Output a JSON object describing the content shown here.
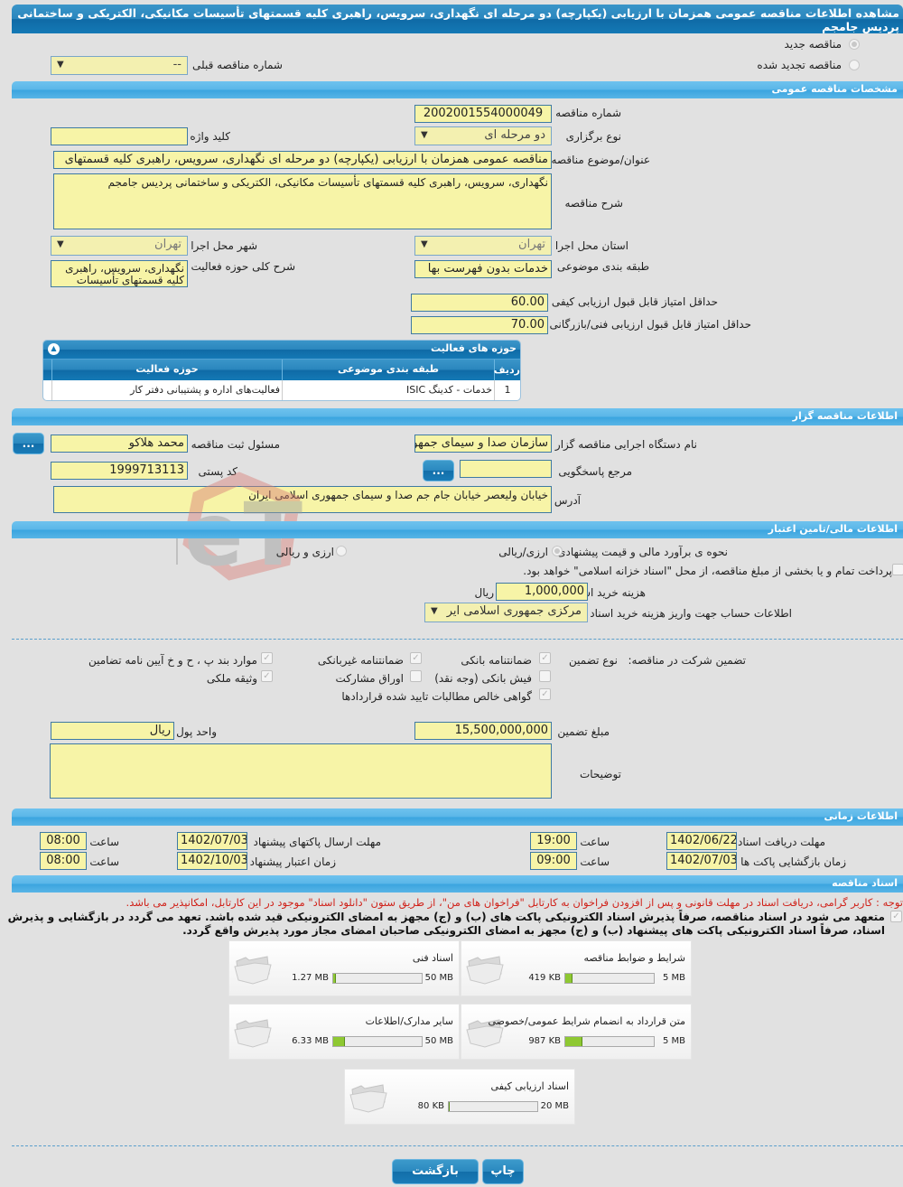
{
  "page_title": "مشاهده اطلاعات مناقصه عمومی همزمان با ارزیابی (یکپارچه) دو مرحله ای نگهداری، سرویس، راهبری کلیه قسمتهای تأسیسات مکانیکی، الکتریکی و ساختمانی پردیس جامجم",
  "tender_type": {
    "new_label": "مناقصه جدید",
    "renewed_label": "مناقصه تجدید شده",
    "prev_number_label": "شماره مناقصه قبلی",
    "prev_number_value": "--"
  },
  "general": {
    "section_title": "مشخصات مناقصه عمومی",
    "tender_number_label": "شماره مناقصه",
    "tender_number": "2002001554000049",
    "holding_type_label": "نوع برگزاری",
    "holding_type": "دو مرحله ای",
    "keyword_label": "کلید واژه",
    "keyword": "",
    "subject_label": "عنوان/موضوع مناقصه",
    "subject": "مناقصه عمومی همزمان با ارزیابی (یکپارچه) دو مرحله ای نگهداری، سرویس، راهبری کلیه قسمتهای",
    "description_label": "شرح مناقصه",
    "description": "نگهداری، سرویس، راهبری کلیه قسمتهای تأسیسات مکانیکی، الکتریکی و ساختمانی پردیس جامجم",
    "province_label": "استان محل اجرا",
    "province": "تهران",
    "city_label": "شهر محل اجرا",
    "city": "تهران",
    "category_label": "طبقه بندی موضوعی",
    "category": "خدمات بدون فهرست بها",
    "activity_desc_label": "شرح کلی حوزه فعالیت",
    "activity_desc": "نگهداری، سرویس، راهبری کلیه قسمتهای تأسیسات",
    "min_quality_label": "حداقل امتیاز قابل قبول ارزیابی کیفی",
    "min_quality": "60.00",
    "min_tech_label": "حداقل امتیاز قابل قبول ارزیابی فنی/بازرگانی",
    "min_tech": "70.00"
  },
  "activity_grid": {
    "title": "حوزه های فعالیت",
    "columns": [
      "ردیف",
      "طبقه بندی موضوعی",
      "حوزه فعالیت"
    ],
    "rows": [
      {
        "index": "1",
        "category": "خدمات - کدینگ ISIC",
        "field": "فعالیت‌های  اداره و پشتیبانی دفتر کار"
      }
    ]
  },
  "organizer": {
    "section_title": "اطلاعات مناقصه گزار",
    "org_name_label": "نام دستگاه اجرایی مناقصه گزار",
    "org_name": "سازمان صدا و سیمای جمهوری اسلامی ایران",
    "registrar_label": "مسئول ثبت مناقصه",
    "registrar": "محمد هلاکو",
    "reference_label": "مرجع پاسخگویی",
    "reference": "",
    "postal_label": "کد پستی",
    "postal": "1999713113",
    "address_label": "آدرس",
    "address": "خیابان ولیعصر خیابان جام جم صدا و سیمای جمهوری اسلامی ایران",
    "dots_label": "..."
  },
  "financial": {
    "section_title": "اطلاعات مالی/تامین اعتبار",
    "estimate_label": "نحوه ی برآورد مالی و قیمت پیشنهادی",
    "opt_rial": "ارزی/ریالی",
    "opt_fx_rial": "ارزی و ریالی",
    "treasury_note": "پرداخت تمام و یا بخشی از مبلغ مناقصه، از محل \"اسناد خزانه اسلامی\" خواهد بود.",
    "doc_fee_label": "هزینه خرید اسناد",
    "doc_fee": "1,000,000",
    "doc_fee_unit": "ریال",
    "account_label": "اطلاعات حساب جهت واریز هزینه خرید اسناد",
    "account": "مرکزی جمهوری اسلامی ایر"
  },
  "guarantee": {
    "title_label": "تضمین شرکت در مناقصه:",
    "type_label": "نوع تضمین",
    "options": [
      {
        "label": "ضمانتنامه بانکی",
        "checked": true
      },
      {
        "label": "ضمانتنامه غیربانکی",
        "checked": true
      },
      {
        "label": "موارد بند پ ، ح و خ آیین نامه تضامین",
        "checked": true
      },
      {
        "label": "فیش بانکی (وجه نقد)",
        "checked": false
      },
      {
        "label": "اوراق مشارکت",
        "checked": false
      },
      {
        "label": "وثیقه ملکی",
        "checked": true
      },
      {
        "label": "گواهی خالص مطالبات تایید شده قراردادها",
        "checked": true
      }
    ],
    "amount_label": "مبلغ تضمین",
    "amount": "15,500,000,000",
    "currency_label": "واحد پول",
    "currency": "ریال",
    "notes_label": "توضیحات",
    "notes": ""
  },
  "timing": {
    "section_title": "اطلاعات زمانی",
    "hour_label": "ساعت",
    "doc_deadline_label": "مهلت دریافت اسناد",
    "doc_deadline": "1402/06/22",
    "doc_deadline_time": "19:00",
    "submit_deadline_label": "مهلت ارسال پاکتهای پیشنهاد",
    "submit_deadline": "1402/07/03",
    "submit_deadline_time": "08:00",
    "opening_label": "زمان بازگشایی پاکت ها",
    "opening": "1402/07/03",
    "opening_time": "09:00",
    "validity_label": "زمان اعتبار پیشنهاد",
    "validity": "1402/10/03",
    "validity_time": "08:00"
  },
  "documents": {
    "section_title": "اسناد مناقصه",
    "notice": "توجه : کاربر گرامی، دریافت اسناد در مهلت قانونی و پس از افزودن فراخوان به کارتابل \"فراخوان های من\"، از طریق ستون \"دانلود اسناد\" موجود در این کارتابل، امکانپذیر می باشد.",
    "commitment": "متعهد می شود در اسناد مناقصه، صرفاً پذیرش اسناد الکترونیکی پاکت های (ب) و (ج) مجهز به امضای الکترونیکی قید شده باشد. تعهد می گردد در بازگشایی و پذیرش اسناد، صرفاً اسناد الکترونیکی پاکت های پیشنهاد (ب) و (ج) مجهز به امضای الکترونیکی صاحبان امضای مجاز مورد پذیرش واقع گردد.",
    "items": [
      {
        "name": "شرایط و ضوابط مناقصه",
        "size": "419 KB",
        "max": "5 MB",
        "fill_percent": 8
      },
      {
        "name": "اسناد فنی",
        "size": "1.27 MB",
        "max": "50 MB",
        "fill_percent": 3
      },
      {
        "name": "متن قرارداد به انضمام شرایط عمومی/خصوصی",
        "size": "987 KB",
        "max": "5 MB",
        "fill_percent": 19
      },
      {
        "name": "سایر مدارک/اطلاعات",
        "size": "6.33 MB",
        "max": "50 MB",
        "fill_percent": 13
      },
      {
        "name": "اسناد ارزیابی کیفی",
        "size": "80 KB",
        "max": "20 MB",
        "fill_percent": 1
      }
    ]
  },
  "buttons": {
    "print": "چاپ",
    "back": "بازگشت"
  },
  "watermark": "AriaTender.neT",
  "colors": {
    "field_bg": "#f7f4a7",
    "header_blue": "#1479b5",
    "section_blue": "#5ab6e8",
    "progress_green": "#8ec832",
    "notice_red": "#d0221a"
  }
}
